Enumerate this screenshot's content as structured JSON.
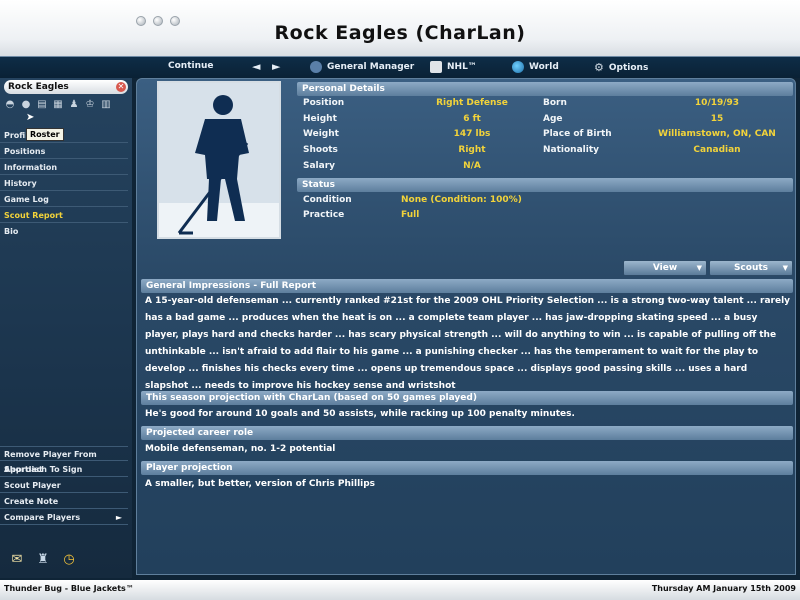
{
  "window": {
    "title": "Rock Eagles (CharLan)"
  },
  "nav": {
    "continue": "Continue",
    "back": "◄",
    "forward": "►",
    "general_manager": "General Manager",
    "nhl": "NHL™",
    "world": "World",
    "options": "Options"
  },
  "sidebar": {
    "team": "Rock Eagles",
    "close": "✕",
    "tooltip": "Roster",
    "items": [
      {
        "label": "Profile"
      },
      {
        "label": "Positions"
      },
      {
        "label": "Information"
      },
      {
        "label": "History"
      },
      {
        "label": "Game Log"
      },
      {
        "label": "Scout Report"
      },
      {
        "label": "Bio"
      }
    ],
    "actions": [
      {
        "label": "Remove Player From Shortlist"
      },
      {
        "label": "Approach To Sign"
      },
      {
        "label": "Scout Player"
      },
      {
        "label": "Create Note"
      },
      {
        "label": "Compare Players"
      }
    ],
    "compare_arrow": "►"
  },
  "personal": {
    "header": "Personal Details",
    "position_label": "Position",
    "position": "Right Defense",
    "height_label": "Height",
    "height": "6 ft",
    "weight_label": "Weight",
    "weight": "147 lbs",
    "shoots_label": "Shoots",
    "shoots": "Right",
    "salary_label": "Salary",
    "salary": "N/A",
    "born_label": "Born",
    "born": "10/19/93",
    "age_label": "Age",
    "age": "15",
    "pob_label": "Place of Birth",
    "pob": "Williamstown, ON, CAN",
    "nationality_label": "Nationality",
    "nationality": "Canadian"
  },
  "status": {
    "header": "Status",
    "condition_label": "Condition",
    "condition": "None (Condition: 100%)",
    "practice_label": "Practice",
    "practice": "Full"
  },
  "buttons": {
    "view": "View",
    "scouts": "Scouts",
    "caret": "▼"
  },
  "report": {
    "impressions_header": "General Impressions - Full Report",
    "impressions_text": "A 15-year-old defenseman ... currently ranked #21st for the 2009 OHL Priority Selection ... is a strong two-way talent ... rarely has a bad game ... produces when the heat is on ... a complete team player ... has jaw-dropping skating speed ... a busy player, plays hard and checks harder ... has scary physical strength ... will do anything to win ... is capable of pulling off the unthinkable ... isn't afraid to add flair to his game ... a punishing checker ... has the temperament to wait for the play to develop ... finishes his checks every time ... opens up tremendous space ... displays good passing skills ... uses a hard slapshot ... needs to improve his hockey sense and wristshot",
    "projection_header": "This season projection with CharLan (based on 50 games played)",
    "projection_text": "He's good for around 10 goals and 50 assists, while racking up 100 penalty minutes.",
    "career_header": "Projected career role",
    "career_text": "Mobile defenseman, no. 1-2 potential",
    "player_proj_header": "Player projection",
    "player_proj_text": "A smaller, but better, version of Chris Phillips"
  },
  "statusbar": {
    "left": "Thunder Bug - Blue Jackets™",
    "right": "Thursday AM January 15th 2009"
  }
}
